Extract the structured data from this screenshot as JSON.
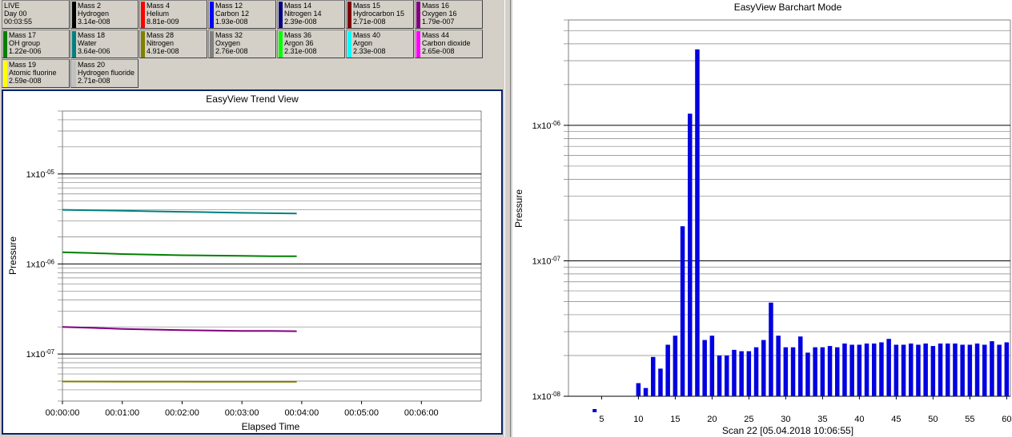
{
  "status_tile": {
    "line1": "LIVE",
    "line2": "Day 00",
    "line3": "00:03:55"
  },
  "mass_tiles": [
    {
      "mass": "Mass 2",
      "name": "Hydrogen",
      "value": "3.14e-008",
      "color": "#000000"
    },
    {
      "mass": "Mass 4",
      "name": "Helium",
      "value": "8.81e-009",
      "color": "#ff0000"
    },
    {
      "mass": "Mass 12",
      "name": "Carbon 12",
      "value": "1.93e-008",
      "color": "#0000ff"
    },
    {
      "mass": "Mass 14",
      "name": "Nitrogen 14",
      "value": "2.39e-008",
      "color": "#000080"
    },
    {
      "mass": "Mass 15",
      "name": "Hydrocarbon 15",
      "value": "2.71e-008",
      "color": "#800000"
    },
    {
      "mass": "Mass 16",
      "name": "Oxygen 16",
      "value": "1.79e-007",
      "color": "#800080"
    },
    {
      "mass": "Mass 17",
      "name": "OH group",
      "value": "1.22e-006",
      "color": "#008000"
    },
    {
      "mass": "Mass 18",
      "name": "Water",
      "value": "3.64e-006",
      "color": "#008080"
    },
    {
      "mass": "Mass 28",
      "name": "Nitrogen",
      "value": "4.91e-008",
      "color": "#808000"
    },
    {
      "mass": "Mass 32",
      "name": "Oxygen",
      "value": "2.76e-008",
      "color": "#808080"
    },
    {
      "mass": "Mass 36",
      "name": "Argon 36",
      "value": "2.31e-008",
      "color": "#00ff00"
    },
    {
      "mass": "Mass 40",
      "name": "Argon",
      "value": "2.33e-008",
      "color": "#00ffff"
    },
    {
      "mass": "Mass 44",
      "name": "Carbon dioxide",
      "value": "2.65e-008",
      "color": "#ff00ff"
    },
    {
      "mass": "Mass 19",
      "name": "Atomic fluorine",
      "value": "2.59e-008",
      "color": "#ffff00"
    },
    {
      "mass": "Mass 20",
      "name": "Hydrogen fluoride",
      "value": "2.71e-008",
      "color": "#c0c0c0"
    }
  ],
  "chart_data": [
    {
      "type": "line",
      "title": "EasyView Trend View",
      "xlabel": "Elapsed Time",
      "ylabel": "Pressure",
      "y_scale": "log",
      "ylim": [
        3e-08,
        5e-05
      ],
      "x_ticks": [
        "00:00:00",
        "00:01:00",
        "00:02:00",
        "00:03:00",
        "00:04:00",
        "00:05:00",
        "00:06:00"
      ],
      "xlim_seconds": [
        0,
        420
      ],
      "y_tick_labels": [
        "1x10-05",
        "1x10-06",
        "1x10-07"
      ],
      "grid": true,
      "series": [
        {
          "color": "#008080",
          "x": [
            0,
            30,
            60,
            90,
            120,
            150,
            180,
            210,
            235
          ],
          "y": [
            4e-06,
            3.95e-06,
            3.9e-06,
            3.85e-06,
            3.8e-06,
            3.75e-06,
            3.7e-06,
            3.66e-06,
            3.64e-06
          ]
        },
        {
          "color": "#008000",
          "x": [
            0,
            30,
            60,
            90,
            120,
            150,
            180,
            210,
            235
          ],
          "y": [
            1.35e-06,
            1.32e-06,
            1.29e-06,
            1.27e-06,
            1.25e-06,
            1.24e-06,
            1.23e-06,
            1.22e-06,
            1.22e-06
          ]
        },
        {
          "color": "#800080",
          "x": [
            0,
            30,
            60,
            90,
            120,
            150,
            180,
            210,
            235
          ],
          "y": [
            2e-07,
            1.95e-07,
            1.9e-07,
            1.87e-07,
            1.84e-07,
            1.82e-07,
            1.8e-07,
            1.8e-07,
            1.79e-07
          ]
        },
        {
          "color": "#808000",
          "x": [
            0,
            60,
            120,
            180,
            235
          ],
          "y": [
            4.95e-08,
            4.93e-08,
            4.92e-08,
            4.91e-08,
            4.91e-08
          ]
        }
      ]
    },
    {
      "type": "bar",
      "title": "EasyView Barchart Mode",
      "xlabel": "Scan 22 [05.04.2018 10:06:55]",
      "ylabel": "Pressure",
      "y_scale": "log",
      "ylim": [
        1e-08,
        6e-06
      ],
      "xlim": [
        0.5,
        60.5
      ],
      "x_ticks": [
        5,
        10,
        15,
        20,
        25,
        30,
        35,
        40,
        45,
        50,
        55,
        60
      ],
      "y_tick_labels": [
        "1x10-06",
        "1x10-07",
        "1x10-08"
      ],
      "grid": true,
      "bar_color": "#0000e0",
      "x": [
        10,
        11,
        12,
        13,
        14,
        15,
        16,
        17,
        18,
        19,
        20,
        21,
        22,
        23,
        24,
        25,
        26,
        27,
        28,
        29,
        30,
        31,
        32,
        33,
        34,
        35,
        36,
        37,
        38,
        39,
        40,
        41,
        42,
        43,
        44,
        45,
        46,
        47,
        48,
        49,
        50,
        51,
        52,
        53,
        54,
        55,
        56,
        57,
        58,
        59,
        60
      ],
      "values": [
        1.25e-08,
        1.15e-08,
        1.95e-08,
        1.6e-08,
        2.4e-08,
        2.8e-08,
        1.8e-07,
        1.22e-06,
        3.64e-06,
        2.6e-08,
        2.8e-08,
        2e-08,
        2e-08,
        2.2e-08,
        2.15e-08,
        2.15e-08,
        2.3e-08,
        2.6e-08,
        4.91e-08,
        2.8e-08,
        2.3e-08,
        2.3e-08,
        2.76e-08,
        2.1e-08,
        2.3e-08,
        2.3e-08,
        2.35e-08,
        2.3e-08,
        2.45e-08,
        2.4e-08,
        2.4e-08,
        2.45e-08,
        2.45e-08,
        2.5e-08,
        2.65e-08,
        2.4e-08,
        2.4e-08,
        2.45e-08,
        2.4e-08,
        2.45e-08,
        2.35e-08,
        2.45e-08,
        2.45e-08,
        2.45e-08,
        2.4e-08,
        2.4e-08,
        2.45e-08,
        2.4e-08,
        2.55e-08,
        2.4e-08,
        2.5e-08
      ]
    }
  ]
}
